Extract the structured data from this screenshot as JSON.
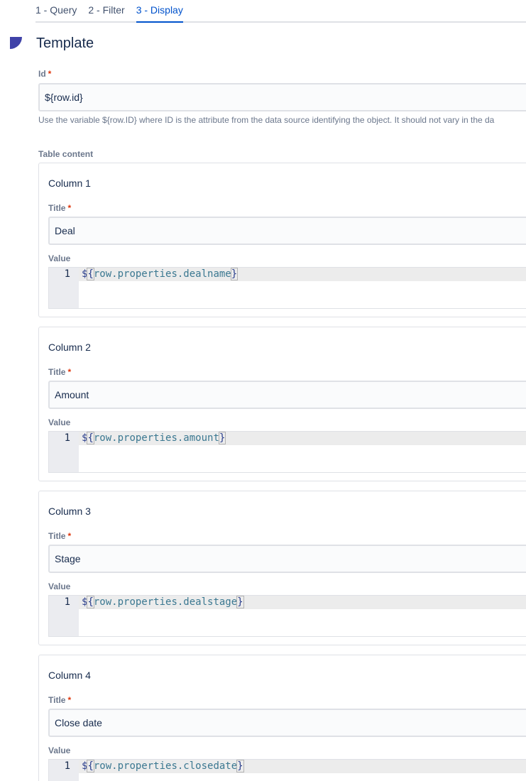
{
  "tabs": [
    {
      "label": "1 - Query",
      "active": false
    },
    {
      "label": "2 - Filter",
      "active": false
    },
    {
      "label": "3 - Display",
      "active": true
    }
  ],
  "section": {
    "title": "Template",
    "icon": "quarter-circle-icon"
  },
  "id_field": {
    "label": "Id",
    "required": "*",
    "value": "${row.id}",
    "helper": "Use the variable ${row.ID} where ID is the attribute from the data source identifying the object. It should not vary in the da"
  },
  "table_content": {
    "label": "Table content",
    "columns": [
      {
        "heading": "Column 1",
        "title_label": "Title",
        "title_value": "Deal",
        "value_label": "Value",
        "line_number": "1",
        "code_prefix": "$",
        "code_open": "{",
        "code_body": "row.properties.dealname",
        "code_close": "}"
      },
      {
        "heading": "Column 2",
        "title_label": "Title",
        "title_value": "Amount",
        "value_label": "Value",
        "line_number": "1",
        "code_prefix": "$",
        "code_open": "{",
        "code_body": "row.properties.amount",
        "code_close": "}"
      },
      {
        "heading": "Column 3",
        "title_label": "Title",
        "title_value": "Stage",
        "value_label": "Value",
        "line_number": "1",
        "code_prefix": "$",
        "code_open": "{",
        "code_body": "row.properties.dealstage",
        "code_close": "}"
      },
      {
        "heading": "Column 4",
        "title_label": "Title",
        "title_value": "Close date",
        "value_label": "Value",
        "line_number": "1",
        "code_prefix": "$",
        "code_open": "{",
        "code_body": "row.properties.closedate",
        "code_close": "}"
      }
    ]
  },
  "colors": {
    "accent": "#0052cc",
    "section_icon": "#3f42a8",
    "required": "#de350b"
  }
}
